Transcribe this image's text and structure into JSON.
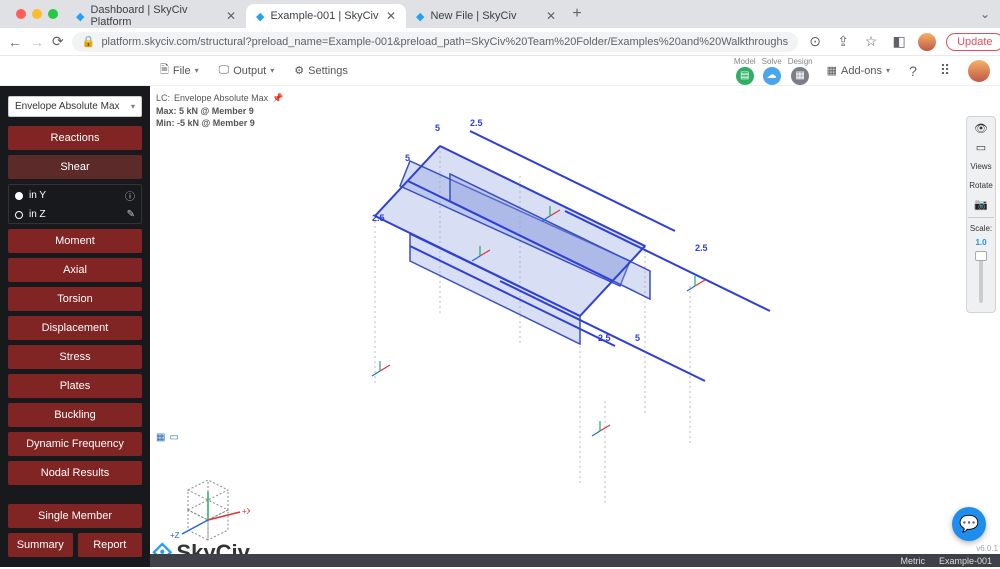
{
  "browser": {
    "tabs": [
      {
        "title": "Dashboard | SkyCiv Platform"
      },
      {
        "title": "Example-001 | SkyCiv"
      },
      {
        "title": "New File | SkyCiv"
      }
    ],
    "url": "platform.skyciv.com/structural?preload_name=Example-001&preload_path=SkyCiv%20Team%20Folder/Examples%20and%20Walkthroughs",
    "update_label": "Update"
  },
  "appbar": {
    "file": "File",
    "output": "Output",
    "settings": "Settings",
    "badges": {
      "model": "Model",
      "solve": "Solve",
      "design": "Design"
    },
    "addons": "Add-ons"
  },
  "sidebar": {
    "dropdown": "Envelope Absolute Max",
    "buttons": {
      "reactions": "Reactions",
      "shear": "Shear",
      "moment": "Moment",
      "axial": "Axial",
      "torsion": "Torsion",
      "displacement": "Displacement",
      "stress": "Stress",
      "plates": "Plates",
      "buckling": "Buckling",
      "dynfreq": "Dynamic Frequency",
      "nodal": "Nodal Results",
      "single": "Single Member",
      "summary": "Summary",
      "report": "Report"
    },
    "subopts": {
      "iny": "in Y",
      "inz": "in Z"
    }
  },
  "info": {
    "lc_label": "LC:",
    "lc_value": "Envelope Absolute Max",
    "max": "Max: 5 kN @ Member 9",
    "min": "Min: -5 kN @ Member 9"
  },
  "right_tools": {
    "views": "Views",
    "rotate": "Rotate",
    "scale_label": "Scale:",
    "scale_value": "1.0"
  },
  "diagram_labels": {
    "a": "5",
    "b": "2.5",
    "c": "5",
    "d": "2.5",
    "e": "2.5",
    "f": "5",
    "g": "2.5"
  },
  "axes": {
    "x": "+X",
    "z": "+Z"
  },
  "logo": "SkyCiv",
  "version": "v6.0.1",
  "status": {
    "units": "Metric",
    "project": "Example-001"
  }
}
